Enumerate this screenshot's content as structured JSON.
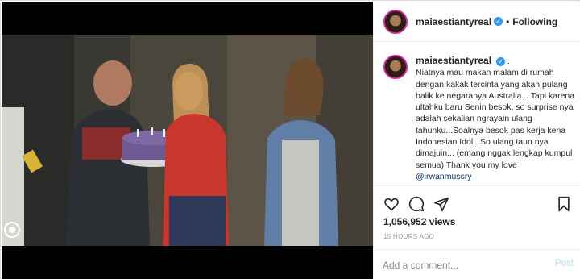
{
  "post": {
    "username": "maiaestiantyreal",
    "follow_status": "Following",
    "separator": "•",
    "verified_mark": "✓",
    "caption_username": "maiaestiantyreal",
    "caption_trailing_dot": ".",
    "caption_text": "Niatnya mau makan malam di rumah dengan kakak tercinta yang akan pulang balik ke negaranya Australia... Tapi karena ultahku baru Senin besok, so surprise nya adalah sekalian ngrayain ulang tahunku...Soalnya besok pas kerja kena Indonesian Idol.. So ulang taun nya dimajuin... (emang nggak lengkap kumpul semua) Thank you my love",
    "caption_mention": "@irwanmussry",
    "views": "1,056,952 views",
    "time_ago": "15 HOURS AGO"
  },
  "comment": {
    "placeholder": "Add a comment...",
    "post_label": "Post"
  },
  "icons": {
    "like": "heart-icon",
    "comment": "comment-icon",
    "share": "share-icon",
    "save": "bookmark-icon",
    "video_indicator": "video-mute-icon"
  },
  "colors": {
    "verified": "#3897f0",
    "mention": "#003569",
    "post_disabled": "#b2dffc",
    "muted_text": "#999999"
  }
}
